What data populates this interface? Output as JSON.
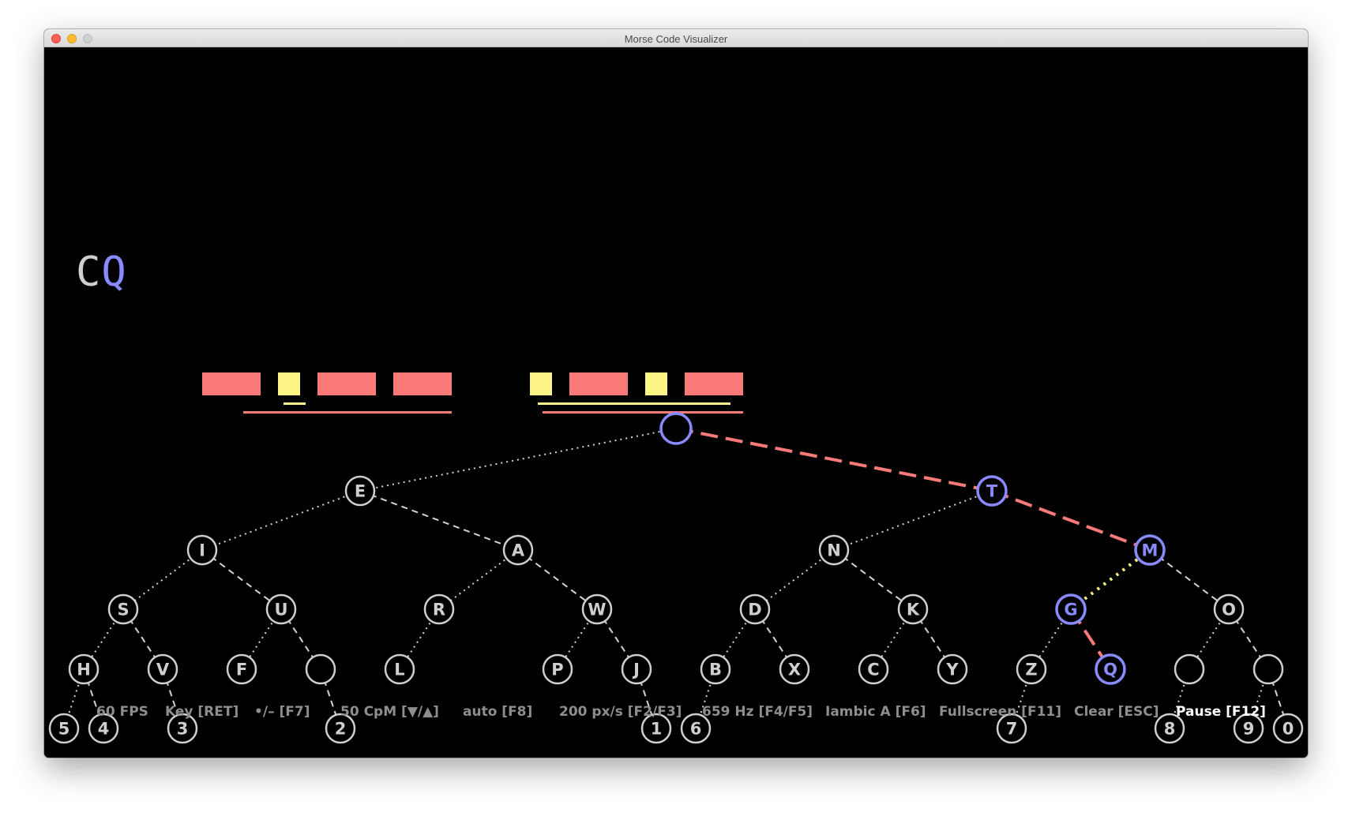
{
  "window": {
    "title": "Morse Code Visualizer"
  },
  "colors": {
    "dash": "#fa7a7a",
    "dot": "#fdf586",
    "highlight": "#8a8aff",
    "node": "#cfcfcf",
    "status": "#8e8e8e",
    "status_active": "#ffffff"
  },
  "decoded_text": [
    {
      "char": "C",
      "current": false
    },
    {
      "char": "Q",
      "current": true
    }
  ],
  "morse_groups": [
    {
      "letter": "C",
      "symbols": [
        "dash",
        "dot",
        "dash",
        "dash"
      ]
    },
    {
      "letter": "Q",
      "symbols": [
        "dot",
        "dash",
        "dot",
        "dash"
      ]
    }
  ],
  "tree": {
    "nodes": [
      {
        "id": "root",
        "label": "",
        "level": 0,
        "highlight": true
      },
      {
        "id": "E",
        "label": "E",
        "level": 1
      },
      {
        "id": "T",
        "label": "T",
        "level": 1,
        "highlight": true
      },
      {
        "id": "I",
        "label": "I",
        "level": 2
      },
      {
        "id": "A",
        "label": "A",
        "level": 2
      },
      {
        "id": "N",
        "label": "N",
        "level": 2
      },
      {
        "id": "M",
        "label": "M",
        "level": 2,
        "highlight": true
      },
      {
        "id": "S",
        "label": "S",
        "level": 3
      },
      {
        "id": "U",
        "label": "U",
        "level": 3
      },
      {
        "id": "R",
        "label": "R",
        "level": 3
      },
      {
        "id": "W",
        "label": "W",
        "level": 3
      },
      {
        "id": "D",
        "label": "D",
        "level": 3
      },
      {
        "id": "K",
        "label": "K",
        "level": 3
      },
      {
        "id": "G",
        "label": "G",
        "level": 3,
        "highlight": true
      },
      {
        "id": "O",
        "label": "O",
        "level": 3
      },
      {
        "id": "H",
        "label": "H",
        "level": 4
      },
      {
        "id": "V",
        "label": "V",
        "level": 4
      },
      {
        "id": "F",
        "label": "F",
        "level": 4
      },
      {
        "id": "UU",
        "label": "",
        "level": 4
      },
      {
        "id": "L",
        "label": "L",
        "level": 4
      },
      {
        "id": "P",
        "label": "P",
        "level": 4
      },
      {
        "id": "J",
        "label": "J",
        "level": 4
      },
      {
        "id": "B",
        "label": "B",
        "level": 4
      },
      {
        "id": "X",
        "label": "X",
        "level": 4
      },
      {
        "id": "C",
        "label": "C",
        "level": 4
      },
      {
        "id": "Y",
        "label": "Y",
        "level": 4
      },
      {
        "id": "Z",
        "label": "Z",
        "level": 4
      },
      {
        "id": "Q",
        "label": "Q",
        "level": 4,
        "highlight": true
      },
      {
        "id": "OE",
        "label": "",
        "level": 4
      },
      {
        "id": "CH",
        "label": "",
        "level": 4
      },
      {
        "id": "5",
        "label": "5",
        "level": 5
      },
      {
        "id": "4",
        "label": "4",
        "level": 5
      },
      {
        "id": "3",
        "label": "3",
        "level": 5
      },
      {
        "id": "2",
        "label": "2",
        "level": 5
      },
      {
        "id": "1",
        "label": "1",
        "level": 5
      },
      {
        "id": "6",
        "label": "6",
        "level": 5
      },
      {
        "id": "7",
        "label": "7",
        "level": 5
      },
      {
        "id": "8",
        "label": "8",
        "level": 5
      },
      {
        "id": "9",
        "label": "9",
        "level": 5
      },
      {
        "id": "0",
        "label": "0",
        "level": 5
      }
    ],
    "edges": [
      {
        "from": "root",
        "to": "E",
        "type": "dot"
      },
      {
        "from": "root",
        "to": "T",
        "type": "dash",
        "active": true
      },
      {
        "from": "E",
        "to": "I",
        "type": "dot"
      },
      {
        "from": "E",
        "to": "A",
        "type": "dash"
      },
      {
        "from": "T",
        "to": "N",
        "type": "dot"
      },
      {
        "from": "T",
        "to": "M",
        "type": "dash",
        "active": true
      },
      {
        "from": "I",
        "to": "S",
        "type": "dot"
      },
      {
        "from": "I",
        "to": "U",
        "type": "dash"
      },
      {
        "from": "A",
        "to": "R",
        "type": "dot"
      },
      {
        "from": "A",
        "to": "W",
        "type": "dash"
      },
      {
        "from": "N",
        "to": "D",
        "type": "dot"
      },
      {
        "from": "N",
        "to": "K",
        "type": "dash"
      },
      {
        "from": "M",
        "to": "G",
        "type": "dot",
        "active": true
      },
      {
        "from": "M",
        "to": "O",
        "type": "dash"
      },
      {
        "from": "S",
        "to": "H",
        "type": "dot"
      },
      {
        "from": "S",
        "to": "V",
        "type": "dash"
      },
      {
        "from": "U",
        "to": "F",
        "type": "dot"
      },
      {
        "from": "U",
        "to": "UU",
        "type": "dash"
      },
      {
        "from": "R",
        "to": "L",
        "type": "dot"
      },
      {
        "from": "W",
        "to": "P",
        "type": "dot"
      },
      {
        "from": "W",
        "to": "J",
        "type": "dash"
      },
      {
        "from": "D",
        "to": "B",
        "type": "dot"
      },
      {
        "from": "D",
        "to": "X",
        "type": "dash"
      },
      {
        "from": "K",
        "to": "C",
        "type": "dot"
      },
      {
        "from": "K",
        "to": "Y",
        "type": "dash"
      },
      {
        "from": "G",
        "to": "Z",
        "type": "dot"
      },
      {
        "from": "G",
        "to": "Q",
        "type": "dash",
        "active": true
      },
      {
        "from": "O",
        "to": "OE",
        "type": "dot"
      },
      {
        "from": "O",
        "to": "CH",
        "type": "dash"
      },
      {
        "from": "H",
        "to": "5",
        "type": "dot"
      },
      {
        "from": "H",
        "to": "4",
        "type": "dash"
      },
      {
        "from": "V",
        "to": "3",
        "type": "dash"
      },
      {
        "from": "UU",
        "to": "2",
        "type": "dash"
      },
      {
        "from": "J",
        "to": "1",
        "type": "dash"
      },
      {
        "from": "B",
        "to": "6",
        "type": "dot"
      },
      {
        "from": "Z",
        "to": "7",
        "type": "dot"
      },
      {
        "from": "OE",
        "to": "8",
        "type": "dot"
      },
      {
        "from": "CH",
        "to": "9",
        "type": "dot"
      },
      {
        "from": "CH",
        "to": "0",
        "type": "dash"
      }
    ]
  },
  "status_bar": [
    {
      "id": "fps",
      "label": "60 FPS",
      "active": false,
      "clickable": false
    },
    {
      "id": "key",
      "label": "Key [RET]",
      "active": false,
      "clickable": true
    },
    {
      "id": "keying",
      "label": "•/–  [F7]",
      "active": false,
      "clickable": true
    },
    {
      "id": "speed",
      "label": "50 CpM [▼/▲]",
      "active": false,
      "clickable": true
    },
    {
      "id": "auto",
      "label": "auto [F8]",
      "active": false,
      "clickable": true
    },
    {
      "id": "scroll",
      "label": "200 px/s [F2/F3]",
      "active": false,
      "clickable": true
    },
    {
      "id": "freq",
      "label": "659 Hz [F4/F5]",
      "active": false,
      "clickable": true
    },
    {
      "id": "mode",
      "label": "Iambic A [F6]",
      "active": false,
      "clickable": true
    },
    {
      "id": "fullscreen",
      "label": "Fullscreen [F11]",
      "active": false,
      "clickable": true
    },
    {
      "id": "clear",
      "label": "Clear [ESC]",
      "active": false,
      "clickable": true
    },
    {
      "id": "pause",
      "label": "Pause [F12]",
      "active": true,
      "clickable": true
    }
  ]
}
